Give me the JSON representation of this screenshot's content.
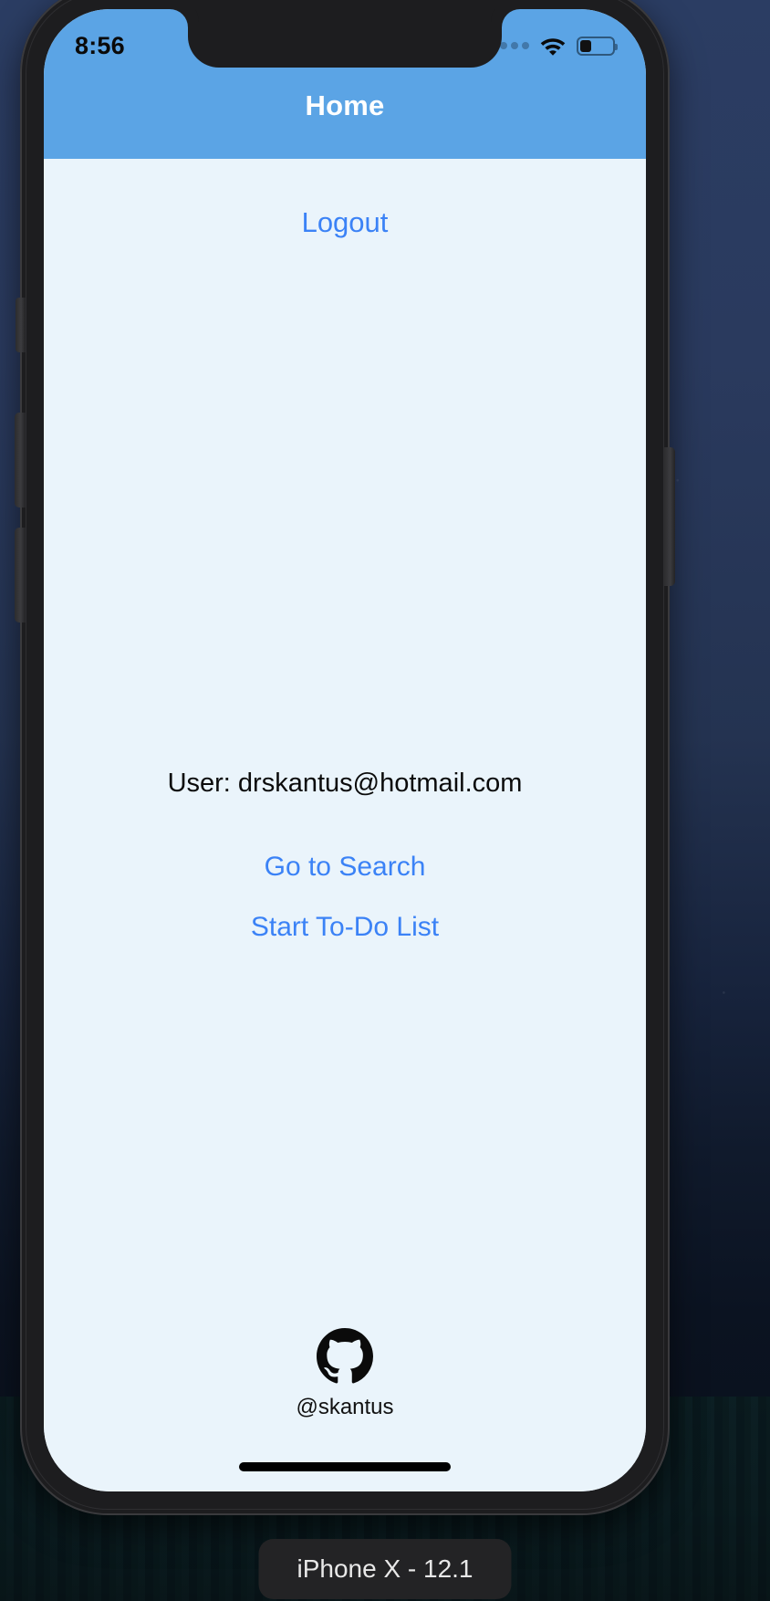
{
  "status_bar": {
    "time": "8:56",
    "signal_icon": "signal-dots-icon",
    "wifi_icon": "wifi-icon",
    "battery_icon": "battery-icon",
    "battery_level_percent": 36
  },
  "nav_bar": {
    "title": "Home",
    "background_color": "#5ba4e5",
    "title_color": "#ffffff"
  },
  "content": {
    "background_color": "#eaf4fb",
    "link_color": "#3b82f6",
    "logout_label": "Logout",
    "user_label": "User: drskantus@hotmail.com",
    "go_to_search_label": "Go to Search",
    "start_todo_label": "Start To-Do List"
  },
  "footer": {
    "github_icon": "github-octocat-icon",
    "handle": "@skantus"
  },
  "home_indicator": {
    "color": "#000000"
  },
  "device": {
    "name_label": "iPhone X - 12.1",
    "pill_background": "#232325",
    "pill_text_color": "#e8e8e8"
  },
  "hardware_buttons": {
    "silent_switch": "silent-switch",
    "volume_up": "volume-up-button",
    "volume_down": "volume-down-button",
    "power": "power-button"
  }
}
